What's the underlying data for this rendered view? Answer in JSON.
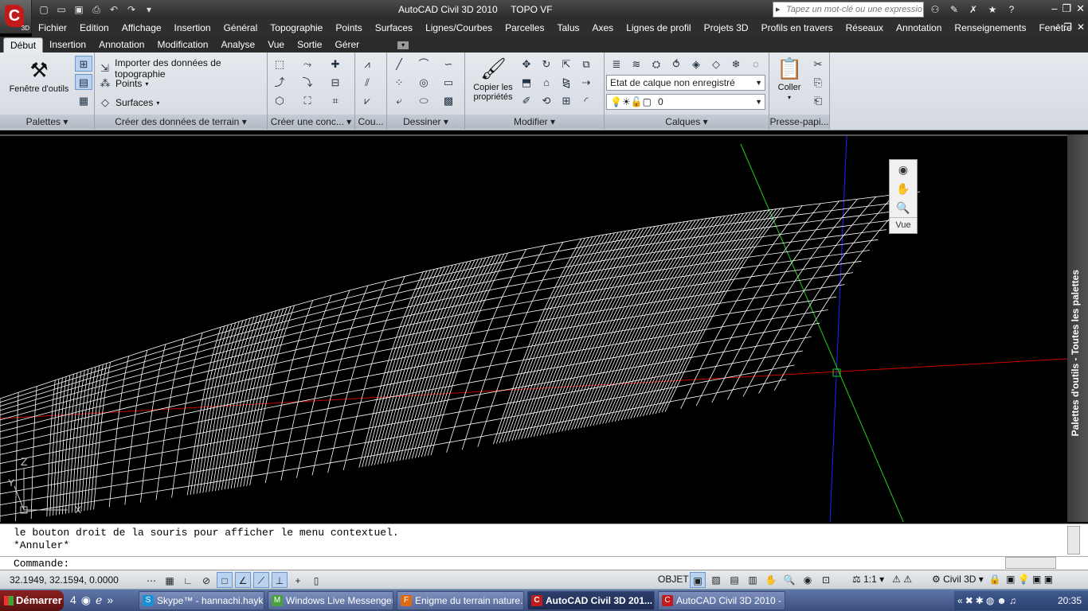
{
  "titlebar": {
    "app_badge": "3D",
    "app_title": "AutoCAD Civil 3D 2010",
    "doc_title": "TOPO VF",
    "search_placeholder": "Tapez un mot-clé ou une expressio",
    "quick_access": [
      "new-icon",
      "open-icon",
      "save-icon",
      "print-icon",
      "undo-icon",
      "redo-icon",
      "dropdown-icon"
    ]
  },
  "menu": {
    "items": [
      "Fichier",
      "Edition",
      "Affichage",
      "Insertion",
      "Général",
      "Topographie",
      "Points",
      "Surfaces",
      "Lignes/Courbes",
      "Parcelles",
      "Talus",
      "Axes",
      "Lignes de profil",
      "Projets 3D",
      "Profils en travers",
      "Réseaux",
      "Annotation",
      "Renseignements",
      "Fenêtre"
    ]
  },
  "ribbon_tabs": {
    "items": [
      "Début",
      "Insertion",
      "Annotation",
      "Modification",
      "Analyse",
      "Vue",
      "Sortie",
      "Gérer"
    ],
    "active": "Début"
  },
  "ribbon": {
    "palettes": {
      "title": "Palettes",
      "tool_window": "Fenêtre d'outils"
    },
    "ground_data": {
      "title": "Créer des données de terrain",
      "import": "Importer des données de topographie",
      "points": "Points",
      "surfaces": "Surfaces"
    },
    "design": {
      "title": "Créer une conc..."
    },
    "cou": {
      "title": "Cou..."
    },
    "draw": {
      "title": "Dessiner"
    },
    "modify": {
      "title": "Modifier",
      "copy_props": "Copier les propriétés"
    },
    "layers": {
      "title": "Calques",
      "layer_state": "Etat de calque non enregistré",
      "current_layer": "0"
    },
    "clipboard": {
      "title": "Presse-papi...",
      "paste": "Coller"
    }
  },
  "viewport": {
    "nav_label": "Vue",
    "ucs_z": "Z",
    "ucs_y": "Y",
    "ucs_x": "X"
  },
  "palette": {
    "label": "Palettes d'outils - Toutes les palettes"
  },
  "command": {
    "line1": "le bouton droit de la souris pour afficher le menu contextuel.",
    "line2": "*Annuler*",
    "prompt": "Commande:"
  },
  "status": {
    "coords": "32.1949, 32.1594, 0.0000",
    "objet": "OBJET",
    "scale": "1:1",
    "workspace": "Civil 3D"
  },
  "taskbar": {
    "start": "Démarrer",
    "quicklaunch_count": "4",
    "tasks": [
      {
        "label": "Skype™ - hannachi.haykel",
        "color": "#1a8fd6",
        "icon": "S"
      },
      {
        "label": "Windows Live Messenger",
        "color": "#4aa13c",
        "icon": "M"
      },
      {
        "label": "Enigme du terrain nature...",
        "color": "#e06a10",
        "icon": "F"
      },
      {
        "label": "AutoCAD Civil 3D 201...",
        "color": "#c21a1a",
        "icon": "C"
      },
      {
        "label": "AutoCAD Civil 3D 2010 - ...",
        "color": "#c21a1a",
        "icon": "C"
      }
    ],
    "active_task_index": 3,
    "clock": "20:35"
  }
}
